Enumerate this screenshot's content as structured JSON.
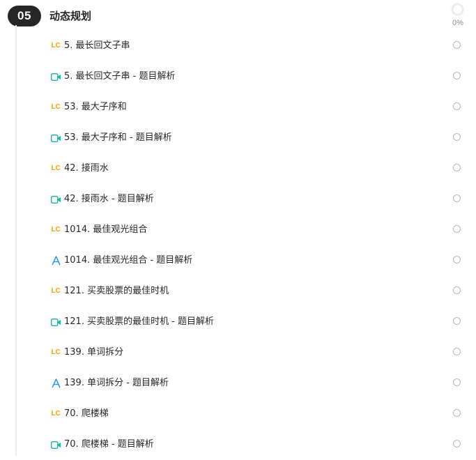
{
  "section": {
    "number": "05",
    "title": "动态规划",
    "progress_text": "0%",
    "progress_value": 0
  },
  "colors": {
    "badge_bg": "#262626",
    "leetcode_icon": "#f0a500",
    "video_icon": "#1fb8a5",
    "article_icon": "#1890ff"
  },
  "lessons": [
    {
      "icon": "leetcode-icon",
      "title": "5. 最长回文子串"
    },
    {
      "icon": "video-icon",
      "title": "5. 最长回文子串 - 题目解析"
    },
    {
      "icon": "leetcode-icon",
      "title": "53. 最大子序和"
    },
    {
      "icon": "video-icon",
      "title": "53. 最大子序和 - 题目解析"
    },
    {
      "icon": "leetcode-icon",
      "title": "42. 接雨水"
    },
    {
      "icon": "video-icon",
      "title": "42. 接雨水 - 题目解析"
    },
    {
      "icon": "leetcode-icon",
      "title": "1014. 最佳观光组合"
    },
    {
      "icon": "article-icon",
      "title": "1014. 最佳观光组合 - 题目解析"
    },
    {
      "icon": "leetcode-icon",
      "title": "121. 买卖股票的最佳时机"
    },
    {
      "icon": "video-icon",
      "title": "121. 买卖股票的最佳时机 - 题目解析"
    },
    {
      "icon": "leetcode-icon",
      "title": "139. 单词拆分"
    },
    {
      "icon": "article-icon",
      "title": "139. 单词拆分 - 题目解析"
    },
    {
      "icon": "leetcode-icon",
      "title": "70. 爬楼梯"
    },
    {
      "icon": "video-icon",
      "title": "70. 爬楼梯 - 题目解析"
    }
  ]
}
